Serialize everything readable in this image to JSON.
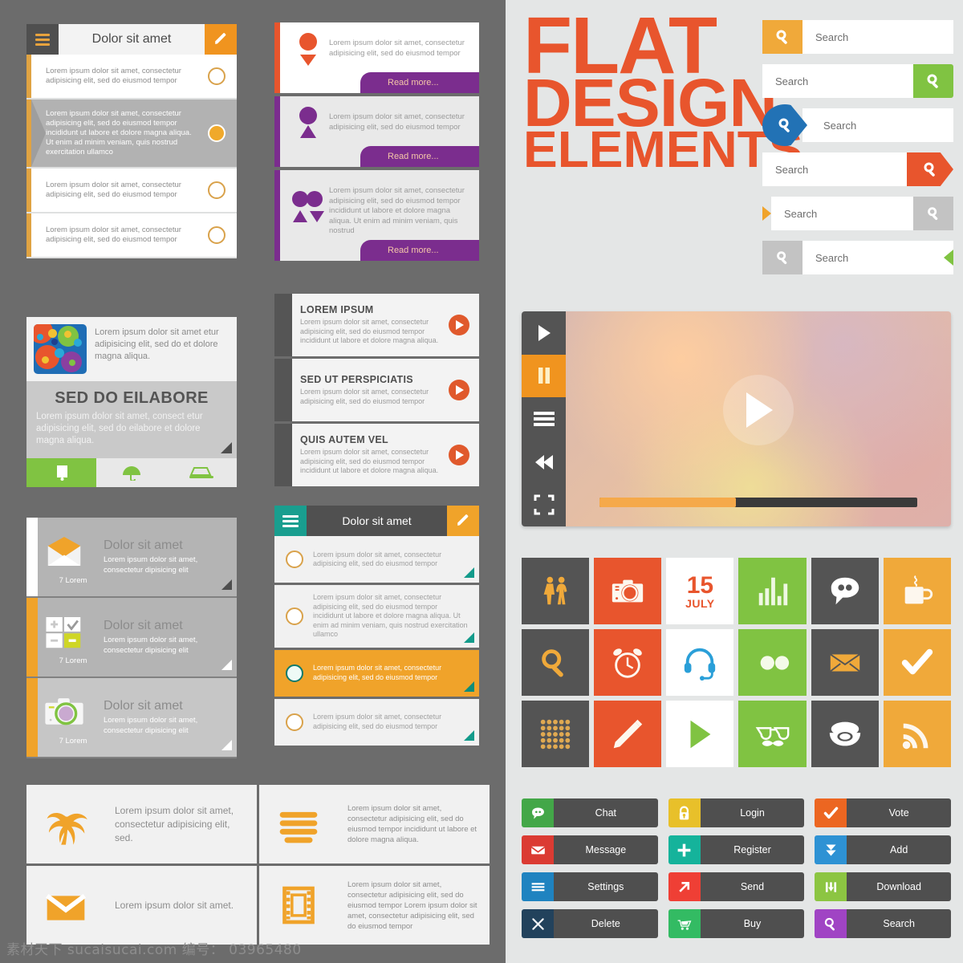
{
  "palette": {
    "orange": "#f0941f",
    "orange_light": "#f0a92b",
    "red_orange": "#e8552d",
    "purple": "#7b2d8e",
    "green": "#80c342",
    "teal": "#199e8f",
    "blue": "#2272b5",
    "dark_gray": "#4f4f4f",
    "panel_gray": "#6c6c6c",
    "right_bg": "#e4e6e6"
  },
  "list_a": {
    "title": "Dolor sit amet",
    "menu_icon": "hamburger-icon",
    "edit_icon": "pencil-icon",
    "rows": [
      {
        "text": "Lorem ipsum dolor sit amet, consectetur adipisicing elit, sed do eiusmod tempor",
        "selected": false
      },
      {
        "text": "Lorem ipsum dolor sit amet, consectetur adipisicing elit, sed do eiusmod tempor incididunt ut labore et dolore magna aliqua. Ut enim ad minim veniam, quis nostrud exercitation ullamco",
        "selected": true
      },
      {
        "text": "Lorem ipsum dolor sit amet, consectetur adipisicing elit, sed do eiusmod tempor",
        "selected": false
      },
      {
        "text": "Lorem ipsum dolor sit amet, consectetur adipisicing elit, sed do eiusmod tempor",
        "selected": false
      }
    ]
  },
  "card_b": {
    "thumb_icon": "bubbles-thumbnail",
    "top_text": "Lorem ipsum dolor sit amet etur adipisicing elit, sed do et dolore magna aliqua.",
    "heading": "SED DO EILABORE",
    "body": "Lorem ipsum dolor sit amet, consect etur adipisicing elit, sed do eilabore et dolore magna aliqua.",
    "footer_icons": [
      "phone-icon",
      "umbrella-icon",
      "laptop-icon"
    ]
  },
  "cards_c": [
    {
      "icon": "envelope-open-icon",
      "caption": "7 Lorem",
      "title": "Dolor sit amet",
      "body": "Lorem ipsum dolor sit amet, consectetur dipisicing elit",
      "edge": "#ffffff",
      "bg": "#b4b4b4",
      "corner": "dark"
    },
    {
      "icon": "calculator-icon",
      "caption": "7 Lorem",
      "title": "Dolor sit amet",
      "body": "Lorem ipsum dolor sit amet, consectetur dipisicing elit",
      "edge": "#f0a32a",
      "bg": "#b4b4b4",
      "corner": "white"
    },
    {
      "icon": "camera-icon",
      "caption": "7 Lorem",
      "title": "Dolor sit amet",
      "body": "Lorem ipsum dolor sit amet, consectetur dipisicing elit",
      "edge": "#f0a32a",
      "bg": "#c6c6c6",
      "corner": "white"
    }
  ],
  "grid_d": [
    {
      "icon": "palm-tree-icon",
      "text": "Lorem ipsum dolor sit amet, consectetur adipisicing elit, sed.",
      "big": true
    },
    {
      "icon": "stack-lines-icon",
      "text": "Lorem ipsum dolor sit amet, consectetur adipisicing elit, sed do eiusmod tempor incididunt ut labore et dolore magna aliqua.",
      "big": false
    },
    {
      "icon": "envelope-icon",
      "text": "Lorem ipsum dolor sit amet.",
      "big": true
    },
    {
      "icon": "film-strip-icon",
      "text": "Lorem ipsum dolor sit amet, consectetur adipisicing elit, sed do eiusmod tempor Lorem ipsum dolor sit amet, consectetur adipisicing elit, sed do eiusmod tempor",
      "big": false
    }
  ],
  "cards_e": {
    "read_more_label": "Read more...",
    "items": [
      {
        "text": "Lorem ipsum dolor sit amet, consectetur adipisicing elit, sed do eiusmod tempor",
        "bar": "#e8552d",
        "shape_color": "#e8552d",
        "shape": "circle-triangle-down",
        "bg": "#ffffff"
      },
      {
        "text": "Lorem ipsum dolor sit amet, consectetur adipisicing elit, sed do eiusmod tempor",
        "bar": "#7b2d8e",
        "shape_color": "#7b2d8e",
        "shape": "circle-triangle-up",
        "bg": "#e9e9e9"
      },
      {
        "text": "Lorem ipsum dolor sit amet, consectetur adipisicing elit, sed do eiusmod tempor incididunt ut labore et dolore magna aliqua. Ut enim ad minim veniam, quis nostrud",
        "bar": "#7b2d8e",
        "shape_color": "#7b2d8e",
        "shape": "double-circle-triangles",
        "bg": "#e9e9e9"
      }
    ]
  },
  "cards_f": [
    {
      "heading": "LOREM IPSUM",
      "body": "Lorem ipsum dolor sit amet, consectetur adipisicing elit, sed do eiusmod tempor incididunt ut labore et dolore magna aliqua.",
      "play_icon": "play-circle-icon"
    },
    {
      "heading": "SED UT PERSPICIATIS",
      "body": "Lorem ipsum dolor sit amet, consectetur adipisicing elit, sed do eiusmod tempor",
      "play_icon": "play-circle-icon"
    },
    {
      "heading": "QUIS AUTEM VEL",
      "body": "Lorem ipsum dolor sit amet, consectetur adipisicing elit, sed do eiusmod tempor incididunt ut labore et dolore magna aliqua.",
      "play_icon": "play-circle-icon"
    }
  ],
  "list_g": {
    "title": "Dolor sit amet",
    "menu_icon": "hamburger-icon",
    "edit_icon": "pencil-icon",
    "rows": [
      {
        "text": "Lorem ipsum dolor sit amet, consectetur adipisicing elit, sed do eiusmod tempor",
        "selected": false
      },
      {
        "text": "Lorem ipsum dolor sit amet, consectetur adipisicing elit, sed do eiusmod tempor incididunt ut labore et dolore magna aliqua. Ut enim ad minim veniam, quis nostrud exercitation ullamco",
        "selected": false
      },
      {
        "text": "Lorem ipsum dolor sit amet, consectetur adipisicing elit, sed do eiusmod tempor",
        "selected": true
      },
      {
        "text": "Lorem ipsum dolor sit amet, consectetur adipisicing elit, sed do eiusmod tempor",
        "selected": false
      }
    ]
  },
  "flat_title": {
    "line1": "FLAT",
    "line2": "DESIGN",
    "line3": "ELEMENTS"
  },
  "searches": [
    {
      "placeholder": "Search",
      "btn_color": "#f0a93a",
      "icon": "search-icon",
      "layout": "icon-left-square"
    },
    {
      "placeholder": "Search",
      "btn_color": "#80c342",
      "icon": "search-icon",
      "layout": "icon-right-square"
    },
    {
      "placeholder": "Search",
      "btn_color": "#2272b5",
      "icon": "search-icon",
      "layout": "icon-left-drop"
    },
    {
      "placeholder": "Search",
      "btn_color": "#e8552d",
      "icon": "search-icon",
      "layout": "icon-right-pentagon"
    },
    {
      "placeholder": "Search",
      "btn_color": "#c3c3c3",
      "icon": "search-icon",
      "layout": "arrow-left-gray-right"
    },
    {
      "placeholder": "Search",
      "btn_color": "#c3c3c3",
      "icon": "search-icon",
      "layout": "icon-left-gray-arrow-right"
    }
  ],
  "player": {
    "controls": [
      "play-icon",
      "pause-icon",
      "menu-icon",
      "rewind-icon",
      "fullscreen-icon"
    ],
    "active_control": "pause-icon",
    "big_button": "play-circle-icon",
    "progress_percent": 43
  },
  "icon_grid": [
    {
      "name": "restroom-icon",
      "bg": "#545454",
      "fg": "#f0a93a"
    },
    {
      "name": "camera-icon",
      "bg": "#e8552d",
      "fg": "#fdf7ee"
    },
    {
      "name": "calendar-icon",
      "bg": "#ffffff",
      "fg": "#e8552d",
      "day": "15",
      "month": "JULY"
    },
    {
      "name": "bar-chart-icon",
      "bg": "#80c342",
      "fg": "#eef8e2"
    },
    {
      "name": "speech-bubble-icon",
      "bg": "#545454",
      "fg": "#ffffff"
    },
    {
      "name": "coffee-mug-icon",
      "bg": "#f0a93a",
      "fg": "#fdf7ee"
    },
    {
      "name": "search-icon",
      "bg": "#545454",
      "fg": "#f0a93a"
    },
    {
      "name": "alarm-clock-icon",
      "bg": "#e8552d",
      "fg": "#fdf7ee"
    },
    {
      "name": "headset-icon",
      "bg": "#ffffff",
      "fg": "#2a9fd8"
    },
    {
      "name": "two-dots-icon",
      "bg": "#80c342",
      "fg": "#f4fae9"
    },
    {
      "name": "mail-icon",
      "bg": "#545454",
      "fg": "#f0a93a"
    },
    {
      "name": "check-icon",
      "bg": "#f0a93a",
      "fg": "#ffffff"
    },
    {
      "name": "grid-dots-icon",
      "bg": "#545454",
      "fg": "#e0a951"
    },
    {
      "name": "pencil-icon",
      "bg": "#e8552d",
      "fg": "#fdf7ee"
    },
    {
      "name": "play-icon",
      "bg": "#ffffff",
      "fg": "#80c342"
    },
    {
      "name": "glasses-mustache-icon",
      "bg": "#80c342",
      "fg": "#ffffff"
    },
    {
      "name": "telephone-icon",
      "bg": "#545454",
      "fg": "#ffffff"
    },
    {
      "name": "rss-icon",
      "bg": "#f0a93a",
      "fg": "#fdf7ee"
    }
  ],
  "buttons": [
    {
      "label": "Chat",
      "icon": "chat-icon",
      "color": "#43a748"
    },
    {
      "label": "Login",
      "icon": "lock-icon",
      "color": "#e8c02a"
    },
    {
      "label": "Vote",
      "icon": "check-icon",
      "color": "#ec6621"
    },
    {
      "label": "Message",
      "icon": "envelope-icon",
      "color": "#db3b33"
    },
    {
      "label": "Register",
      "icon": "plus-icon",
      "color": "#15b39b"
    },
    {
      "label": "Add",
      "icon": "down-arrows-icon",
      "color": "#2e92d4"
    },
    {
      "label": "Settings",
      "icon": "lines-icon",
      "color": "#1f83c0"
    },
    {
      "label": "Send",
      "icon": "arrow-up-right-icon",
      "color": "#ef3f35"
    },
    {
      "label": "Download",
      "icon": "download-icon",
      "color": "#8cc542"
    },
    {
      "label": "Delete",
      "icon": "close-icon",
      "color": "#22425c"
    },
    {
      "label": "Buy",
      "icon": "cart-icon",
      "color": "#33bb63"
    },
    {
      "label": "Search",
      "icon": "search-icon",
      "color": "#a044c4"
    }
  ],
  "watermark": "素材天下 sucaisucai.com  编号： 03965480"
}
